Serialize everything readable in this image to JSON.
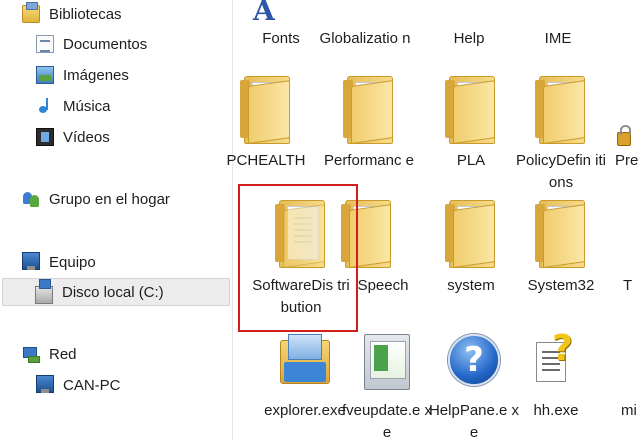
{
  "nav": {
    "items": [
      {
        "label": "Bibliotecas",
        "icon": "library-icon"
      },
      {
        "label": "Documentos",
        "icon": "documents-icon"
      },
      {
        "label": "Imágenes",
        "icon": "pictures-icon"
      },
      {
        "label": "Música",
        "icon": "music-icon"
      },
      {
        "label": "Vídeos",
        "icon": "videos-icon"
      },
      {
        "label": "Grupo en el hogar",
        "icon": "homegroup-icon"
      },
      {
        "label": "Equipo",
        "icon": "computer-icon"
      },
      {
        "label": "Disco local (C:)",
        "icon": "local-disk-icon",
        "selected": true
      },
      {
        "label": "Red",
        "icon": "network-icon"
      },
      {
        "label": "CAN-PC",
        "icon": "pc-icon"
      }
    ]
  },
  "files": {
    "row1": [
      "Fonts",
      "Globalizatio n",
      "Help",
      "IME"
    ],
    "row2": [
      "PCHEALTH",
      "Performanc e",
      "PLA",
      "PolicyDefin itions",
      "Pre"
    ],
    "row3": [
      "SoftwareDis tribution",
      "Speech",
      "system",
      "System32",
      "T"
    ],
    "row4": [
      "explorer.exe",
      "fveupdate.e xe",
      "HelpPane.e xe",
      "hh.exe",
      "mi"
    ]
  },
  "help_glyph": "?",
  "font_glyph": "A",
  "colors": {
    "selection_outline": "#d21d1d",
    "nav_selected_bg": "#ececec",
    "folder_yellow": "#f0cc6c"
  }
}
